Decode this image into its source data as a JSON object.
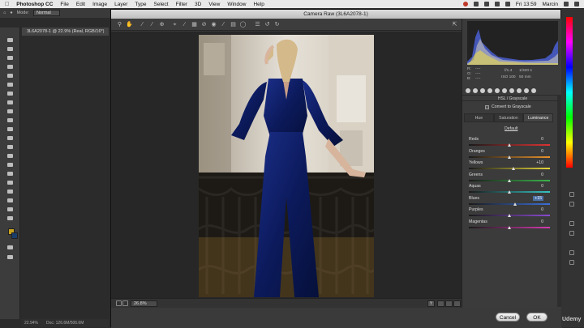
{
  "menubar": {
    "apple": "",
    "items": [
      "Photoshop CC",
      "File",
      "Edit",
      "Image",
      "Layer",
      "Type",
      "Select",
      "Filter",
      "3D",
      "View",
      "Window",
      "Help"
    ],
    "clock": "Fri 13:59",
    "user": "Marcin"
  },
  "options_bar": {
    "mode_label": "Mode:",
    "mode_value": "Normal"
  },
  "document_tab": {
    "title": "3L6A2078-1 @ 22.9% (Real, RGB/16*)"
  },
  "ps_status": {
    "zoom": "22.94%",
    "doc": "Doc: 126.6M/506.6M"
  },
  "dialog": {
    "title": "Camera Raw (3L6A2078-1)",
    "zoom_value": "26.8%",
    "cancel_label": "Cancel",
    "ok_label": "OK"
  },
  "readout": {
    "r": "R:",
    "g": "G:",
    "b": "B:",
    "dash": "----",
    "aperture": "f/1.4",
    "shutter": "1/320 s",
    "iso": "ISO 100",
    "focal": "50 mm"
  },
  "hsl_panel": {
    "header": "HSL / Grayscale",
    "convert_label": "Convert to Grayscale",
    "tabs": [
      "Hue",
      "Saturation",
      "Luminance"
    ],
    "active_tab": "Luminance",
    "default_link": "Default",
    "sliders": [
      {
        "label": "Reds",
        "value": "0",
        "level": 0,
        "colors": [
          "#1a1a1a",
          "#d33"
        ]
      },
      {
        "label": "Oranges",
        "value": "0",
        "level": 0,
        "colors": [
          "#1a1a1a",
          "#e8922a"
        ]
      },
      {
        "label": "Yellows",
        "value": "+10",
        "level": 10,
        "colors": [
          "#1a1a1a",
          "#e6d63a"
        ]
      },
      {
        "label": "Greens",
        "value": "0",
        "level": 0,
        "colors": [
          "#1a1a1a",
          "#3bb54a"
        ]
      },
      {
        "label": "Aquas",
        "value": "0",
        "level": 0,
        "colors": [
          "#1a1a1a",
          "#36c3c3"
        ]
      },
      {
        "label": "Blues",
        "value": "+15",
        "level": 15,
        "colors": [
          "#1a1a1a",
          "#3a6fd8"
        ],
        "highlight": true
      },
      {
        "label": "Purples",
        "value": "0",
        "level": 0,
        "colors": [
          "#1a1a1a",
          "#8a4ad0"
        ]
      },
      {
        "label": "Magentas",
        "value": "0",
        "level": 0,
        "colors": [
          "#1a1a1a",
          "#d63ab0"
        ]
      }
    ]
  },
  "watermark": "Udemy"
}
